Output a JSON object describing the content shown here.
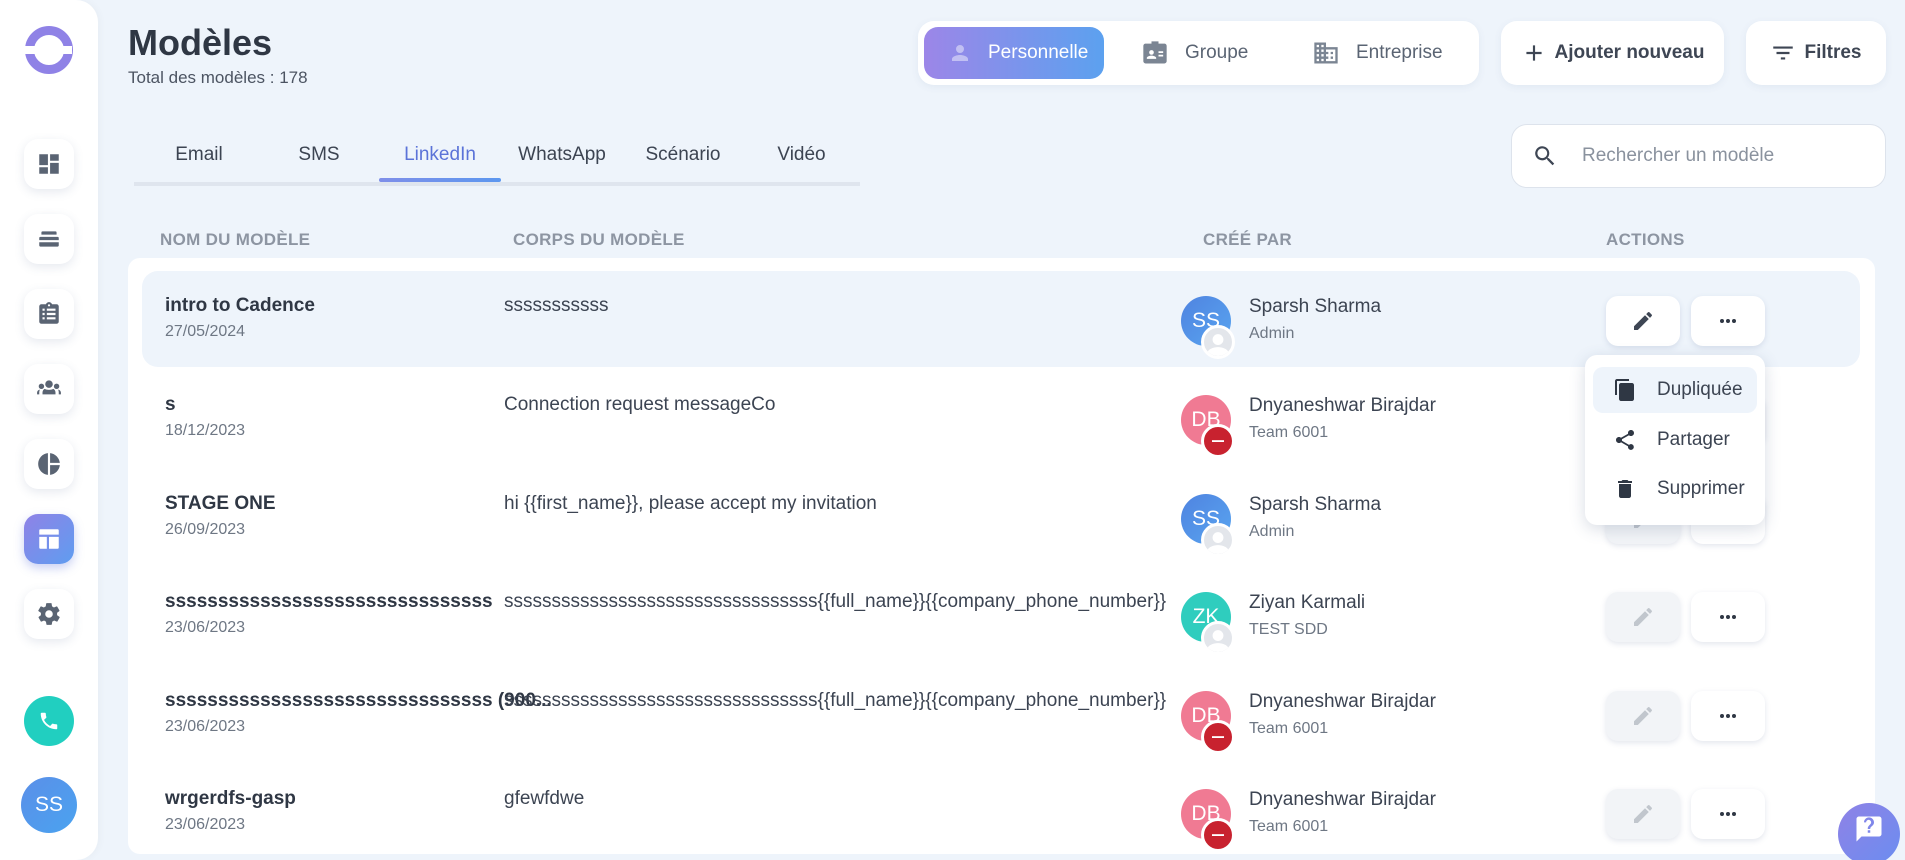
{
  "header": {
    "title": "Modèles",
    "subtitle": "Total des modèles : 178"
  },
  "segments": [
    {
      "label": "Personnelle",
      "icon": "person-icon",
      "active": true
    },
    {
      "label": "Groupe",
      "icon": "id-card-icon",
      "active": false
    },
    {
      "label": "Entreprise",
      "icon": "building-icon",
      "active": false
    }
  ],
  "buttons": {
    "add": "Ajouter nouveau",
    "filters": "Filtres"
  },
  "tabs": [
    "Email",
    "SMS",
    "LinkedIn",
    "WhatsApp",
    "Scénario",
    "Vidéo"
  ],
  "active_tab": "LinkedIn",
  "search": {
    "placeholder": "Rechercher un modèle"
  },
  "columns": [
    "NOM DU MODÈLE",
    "CORPS DU MODÈLE",
    "CRÉÉ PAR",
    "ACTIONS"
  ],
  "rows": [
    {
      "name": "intro to Cadence",
      "date": "27/05/2024",
      "body": "sssssssssss",
      "initials": "SS",
      "creator": "Sparsh Sharma",
      "role": "Admin"
    },
    {
      "name": "s",
      "date": "18/12/2023",
      "body": "Connection request messageCo",
      "initials": "DB",
      "creator": "Dnyaneshwar Birajdar",
      "role": "Team 6001"
    },
    {
      "name": "STAGE ONE",
      "date": "26/09/2023",
      "body": "hi {{first_name}}, please accept my invitation",
      "initials": "SS",
      "creator": "Sparsh Sharma",
      "role": "Admin"
    },
    {
      "name": "sssssssssssssssssssssssssssssss",
      "date": "23/06/2023",
      "body": "sssssssssssssssssssssssssssssssss{{full_name}}{{company_phone_number}}",
      "initials": "ZK",
      "creator": "Ziyan Karmali",
      "role": "TEST SDD"
    },
    {
      "name": "sssssssssssssssssssssssssssssss (900...",
      "date": "23/06/2023",
      "body": "sssssssssssssssssssssssssssssssss{{full_name}}{{company_phone_number}}",
      "initials": "DB",
      "creator": "Dnyaneshwar Birajdar",
      "role": "Team 6001"
    },
    {
      "name": "wrgerdfs-gasp",
      "date": "23/06/2023",
      "body": "gfewfdwe",
      "initials": "DB",
      "creator": "Dnyaneshwar Birajdar",
      "role": "Team 6001"
    }
  ],
  "menu": {
    "duplicate": "Dupliquée",
    "share": "Partager",
    "delete": "Supprimer"
  },
  "sidebar": {
    "user_initials": "SS",
    "items": [
      "dashboard-icon",
      "cadence-layers-icon",
      "clipboard-icon",
      "people-icon",
      "pie-chart-icon",
      "templates-icon",
      "gear-icon"
    ]
  },
  "colors": {
    "accent_start": "#9c86e8",
    "accent_end": "#5ca1ef",
    "background": "#eef4fb"
  }
}
